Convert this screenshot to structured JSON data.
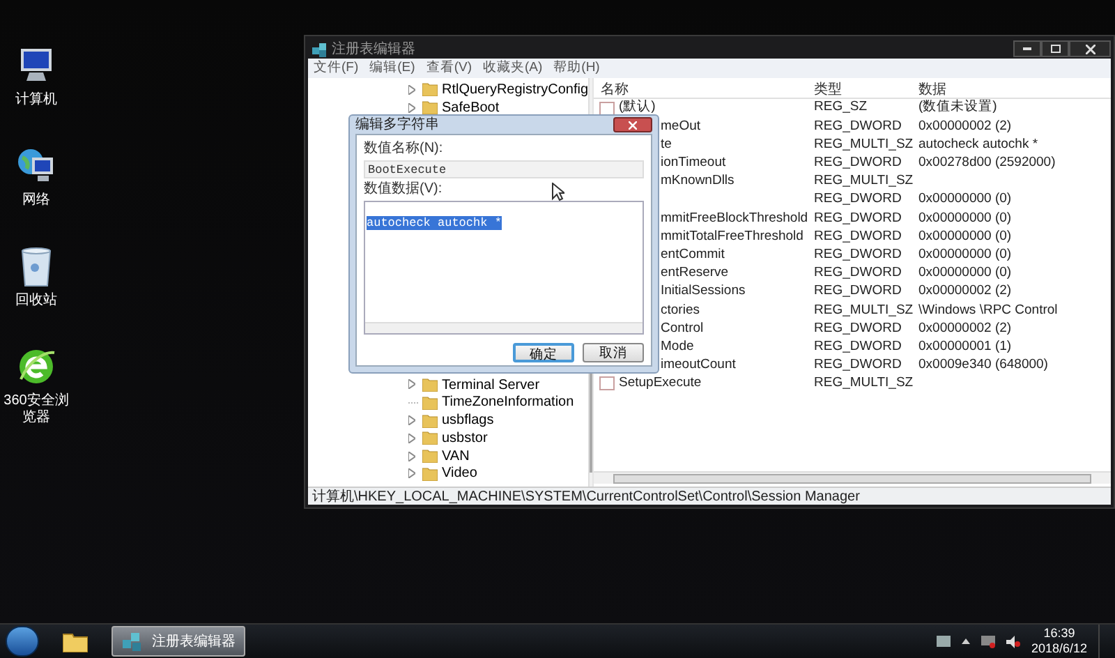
{
  "desktop_icons": [
    {
      "kind": "computer",
      "label": "计算机"
    },
    {
      "kind": "network",
      "label": "网络"
    },
    {
      "kind": "recycle",
      "label": "回收站"
    },
    {
      "kind": "browser",
      "label": "360安全浏览器"
    }
  ],
  "window": {
    "title": "注册表编辑器",
    "menu": [
      "文件(F)",
      "编辑(E)",
      "查看(V)",
      "收藏夹(A)",
      "帮助(H)"
    ],
    "tree": {
      "items_above": [
        {
          "label": "RtlQueryRegistryConfig",
          "expandable": true
        },
        {
          "label": "SafeBoot",
          "expandable": true
        }
      ],
      "items_below": [
        {
          "label": "Terminal Server",
          "expandable": true
        },
        {
          "label": "TimeZoneInformation",
          "expandable": false
        },
        {
          "label": "usbflags",
          "expandable": true
        },
        {
          "label": "usbstor",
          "expandable": true
        },
        {
          "label": "VAN",
          "expandable": true
        },
        {
          "label": "Video",
          "expandable": true
        }
      ]
    },
    "list": {
      "columns": [
        "名称",
        "类型",
        "数据"
      ],
      "rows": [
        {
          "name": "(默认)",
          "kind": "string",
          "type": "REG_SZ",
          "data": "(数值未设置)"
        },
        {
          "name": "meOut",
          "type": "REG_DWORD",
          "data": "0x00000002 (2)"
        },
        {
          "name": "te",
          "type": "REG_MULTI_SZ",
          "data": "autocheck autochk *"
        },
        {
          "name": "ionTimeout",
          "type": "REG_DWORD",
          "data": "0x00278d00 (2592000)"
        },
        {
          "name": "mKnownDlls",
          "type": "REG_MULTI_SZ"
        },
        {
          "type": "REG_DWORD",
          "data": "0x00000000 (0)"
        },
        {
          "name": "mmitFreeBlockThreshold",
          "type": "REG_DWORD",
          "data": "0x00000000 (0)"
        },
        {
          "name": "mmitTotalFreeThreshold",
          "type": "REG_DWORD",
          "data": "0x00000000 (0)"
        },
        {
          "name": "entCommit",
          "type": "REG_DWORD",
          "data": "0x00000000 (0)"
        },
        {
          "name": "entReserve",
          "type": "REG_DWORD",
          "data": "0x00000000 (0)"
        },
        {
          "name": "InitialSessions",
          "type": "REG_DWORD",
          "data": "0x00000002 (2)"
        },
        {
          "name": "ctories",
          "type": "REG_MULTI_SZ",
          "data": "\\Windows \\RPC Control"
        },
        {
          "name": "Control",
          "type": "REG_DWORD",
          "data": "0x00000002 (2)"
        },
        {
          "name": "Mode",
          "type": "REG_DWORD",
          "data": "0x00000001 (1)"
        },
        {
          "name": "imeoutCount",
          "type": "REG_DWORD",
          "data": "0x0009e340 (648000)"
        },
        {
          "name": "SetupExecute",
          "kind": "string",
          "type": "REG_MULTI_SZ"
        }
      ]
    },
    "status_bar": "计算机\\HKEY_LOCAL_MACHINE\\SYSTEM\\CurrentControlSet\\Control\\Session Manager"
  },
  "dialog": {
    "title": "编辑多字符串",
    "name_label": "数值名称(N):",
    "name_value": "BootExecute",
    "data_label": "数值数据(V):",
    "data_value": "autocheck autochk *",
    "data_selected": true,
    "buttons": [
      {
        "label": "确定",
        "default": true
      },
      {
        "label": "取消",
        "default": false
      }
    ]
  },
  "taskbar": {
    "items": [
      {
        "kind": "folder",
        "selected": false
      },
      {
        "kind": "regedit",
        "label": "注册表编辑器",
        "selected": true
      }
    ],
    "time": "16:39",
    "date": "2018/6/12"
  }
}
